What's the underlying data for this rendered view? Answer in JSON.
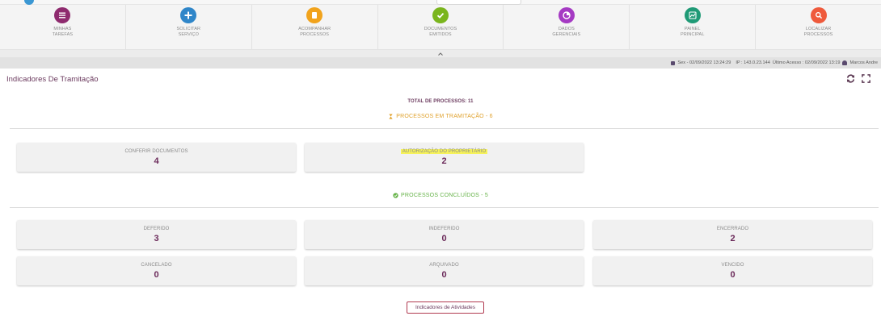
{
  "nav": {
    "items": [
      {
        "label": "MINHAS\nTAREFAS",
        "icon": "list-icon",
        "color": "#8e2a6e"
      },
      {
        "label": "SOLICITAR\nSERVIÇO",
        "icon": "plus-icon",
        "color": "#2f86c9"
      },
      {
        "label": "ACOMPANHAR\nPROCESSOS",
        "icon": "document-icon",
        "color": "#f1a31c"
      },
      {
        "label": "DOCUMENTOS\nEMITIDOS",
        "icon": "check-icon",
        "color": "#7ab51d"
      },
      {
        "label": "DADOS\nGERENCIAIS",
        "icon": "pie-chart-icon",
        "color": "#a53ac3"
      },
      {
        "label": "PAINEL\nPRINCIPAL",
        "icon": "line-chart-icon",
        "color": "#1f9a76"
      },
      {
        "label": "LOCALIZAR\nPROCESSOS",
        "icon": "search-icon",
        "color": "#ef5a3c"
      }
    ]
  },
  "infobar": {
    "datetime": "Sex - 02/09/2022 13:24:29",
    "ip": "IP : 143.0.23.144",
    "last_access": "Último Acesso : 02/09/2022 13:19",
    "user": "Marcos Andre"
  },
  "header": {
    "title": "Indicadores De Tramitação"
  },
  "summary": {
    "total": "TOTAL DE PROCESSOS: 11",
    "in_progress_title": "PROCESSOS EM TRAMITAÇÃO - 6",
    "completed_title": "PROCESSOS CONCLUÍDOS - 5"
  },
  "in_progress": [
    {
      "label": "CONFERIR DOCUMENTOS",
      "value": "4"
    },
    {
      "label": "AUTORIZAÇÃO DO PROPRIETÁRIO",
      "value": "2"
    }
  ],
  "completed": [
    {
      "label": "DEFERIDO",
      "value": "3"
    },
    {
      "label": "INDEFERIDO",
      "value": "0"
    },
    {
      "label": "ENCERRADO",
      "value": "2"
    },
    {
      "label": "CANCELADO",
      "value": "0"
    },
    {
      "label": "ARQUIVADO",
      "value": "0"
    },
    {
      "label": "VENCIDO",
      "value": "0"
    }
  ],
  "footer": {
    "activities_button": "Indicadores de Atividades"
  },
  "colors": {
    "highlight": "#f6f25a",
    "in_progress": "#e0a22e",
    "completed": "#67b34a",
    "brand": "#6b3a5e"
  }
}
